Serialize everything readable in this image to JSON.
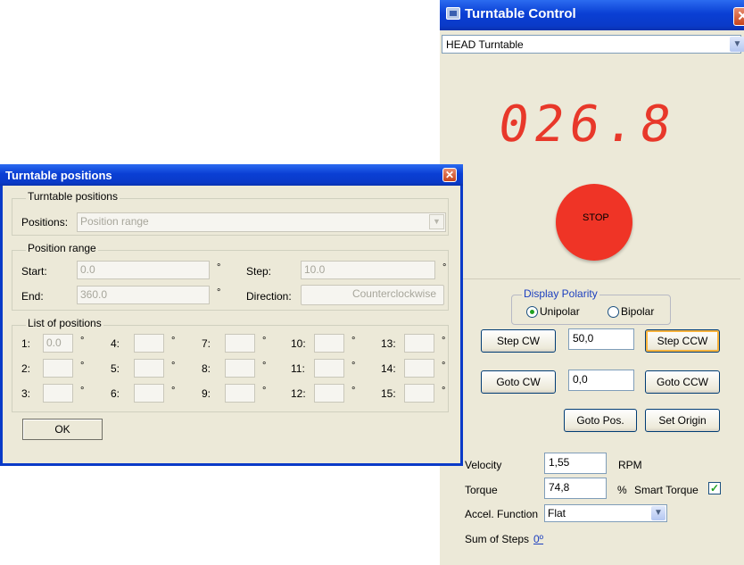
{
  "control_window": {
    "title": "Turntable Control",
    "close_glyph": "✕",
    "device_select": {
      "value": "HEAD Turntable",
      "arrow": "▼"
    },
    "display_value": "026.8",
    "stop_label": "STOP",
    "display_polarity": {
      "legend": "Display Polarity",
      "options": [
        "Unipolar",
        "Bipolar"
      ],
      "selected": "Unipolar"
    },
    "step_cw_label": "Step CW",
    "step_value": "50,0",
    "step_ccw_label": "Step CCW",
    "goto_cw_label": "Goto CW",
    "goto_value": "0,0",
    "goto_ccw_label": "Goto CCW",
    "goto_pos_label": "Goto Pos.",
    "set_origin_label": "Set Origin",
    "velocity_label": "Velocity",
    "velocity_value": "1,55",
    "velocity_unit": "RPM",
    "torque_label": "Torque",
    "torque_value": "74,8",
    "torque_unit": "%",
    "smart_torque_label": "Smart Torque",
    "smart_torque_checked": true,
    "smart_torque_check_glyph": "✓",
    "accel_label": "Accel. Function",
    "accel_value": "Flat",
    "accel_arrow": "▼",
    "sum_label": "Sum of Steps",
    "sum_value": "0º"
  },
  "positions_dialog": {
    "title": "Turntable positions",
    "close_glyph": "✕",
    "group_positions": {
      "legend": "Turntable positions",
      "label": "Positions:",
      "value": "Position range",
      "arrow": "▼"
    },
    "group_range": {
      "legend": "Position range",
      "start_label": "Start:",
      "start_value": "0.0",
      "step_label": "Step:",
      "step_value": "10.0",
      "end_label": "End:",
      "end_value": "360.0",
      "direction_label": "Direction:",
      "direction_value": "Counterclockwise",
      "degree_symbol": "°"
    },
    "group_list": {
      "legend": "List of positions",
      "degree_symbol": "°",
      "labels": [
        "1:",
        "2:",
        "3:",
        "4:",
        "5:",
        "6:",
        "7:",
        "8:",
        "9:",
        "10:",
        "11:",
        "12:",
        "13:",
        "14:",
        "15:"
      ],
      "values": [
        "0.0",
        "",
        "",
        "",
        "",
        "",
        "",
        "",
        "",
        "",
        "",
        "",
        "",
        "",
        ""
      ]
    },
    "ok_label": "OK"
  },
  "colors": {
    "title_bar": "#0a3ac8",
    "window_face": "#ece9d8",
    "display_red": "#e8382a",
    "stop_red": "#ef3426",
    "link_blue": "#1c3fbf"
  }
}
